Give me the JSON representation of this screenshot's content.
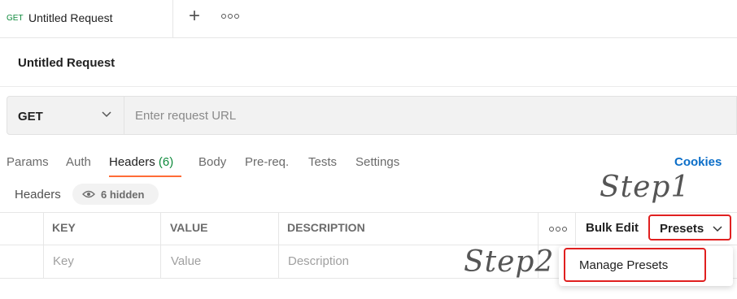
{
  "tabbar": {
    "tab": {
      "method": "GET",
      "title": "Untitled Request"
    },
    "add_label": "+"
  },
  "request": {
    "title": "Untitled Request"
  },
  "urlbar": {
    "method": "GET",
    "url_value": "",
    "url_placeholder": "Enter request URL"
  },
  "subtabs": [
    {
      "label": "Params"
    },
    {
      "label": "Auth"
    },
    {
      "label": "Headers",
      "count": "(6)"
    },
    {
      "label": "Body"
    },
    {
      "label": "Pre-req."
    },
    {
      "label": "Tests"
    },
    {
      "label": "Settings"
    }
  ],
  "cookies_label": "Cookies",
  "headers_meta": {
    "label": "Headers",
    "hidden_text": "6 hidden"
  },
  "table": {
    "columns": [
      "KEY",
      "VALUE",
      "DESCRIPTION"
    ],
    "placeholders": {
      "key": "Key",
      "value": "Value",
      "description": "Description"
    },
    "bulk_edit_label": "Bulk Edit",
    "presets_label": "Presets"
  },
  "presets_menu": {
    "items": [
      {
        "label": "Manage Presets"
      }
    ]
  },
  "annotations": {
    "step1": "Step1",
    "step2": "Step2"
  },
  "colors": {
    "accent": "#ff6c37",
    "link": "#0b6ec8",
    "method_get": "#0f8a3c",
    "highlight": "#e02020"
  }
}
